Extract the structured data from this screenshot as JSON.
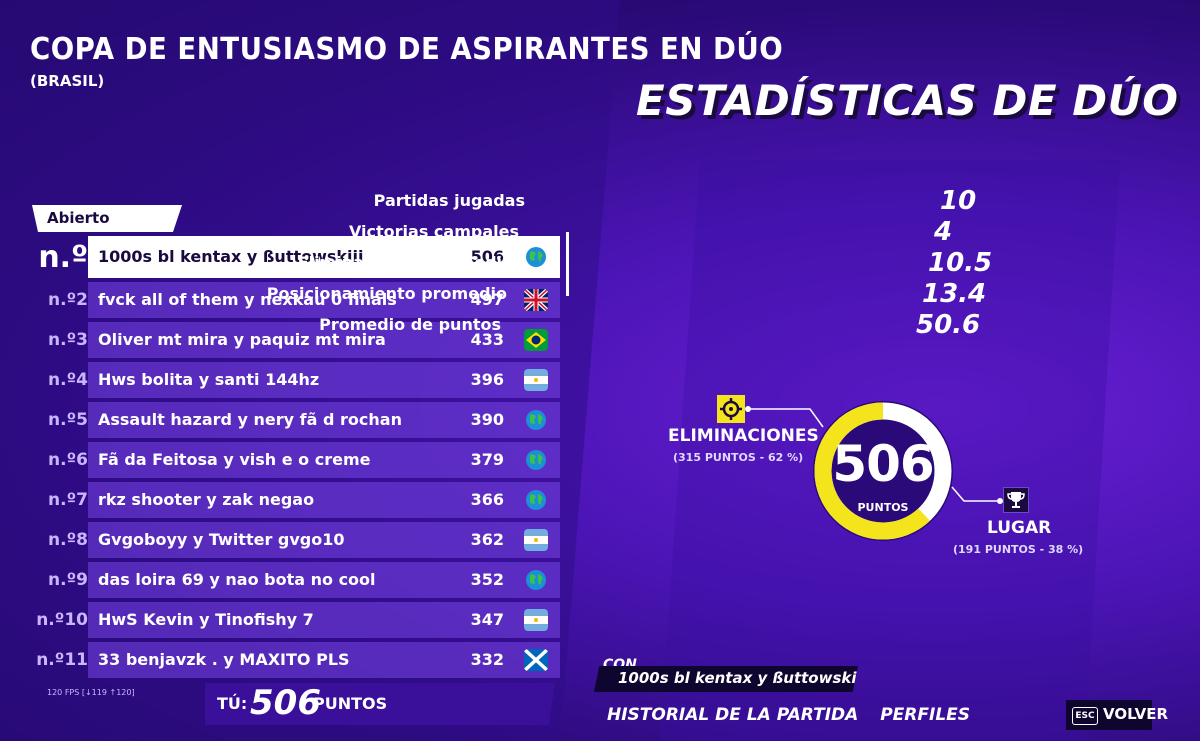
{
  "header": {
    "title": "COPA DE ENTUSIASMO DE ASPIRANTES EN DÚO",
    "subtitle": "(BRASIL)",
    "stats_title": "ESTADÍSTICAS DE DÚO"
  },
  "leaderboard": {
    "tab_label": "Abierto",
    "rows": [
      {
        "rank": "n.º",
        "name": "1000s bl kentax y ßuttowskiii",
        "score": "506",
        "flag": "globe"
      },
      {
        "rank": "n.º2",
        "name": "fvck all of them y nexkau 0 finals",
        "score": "497",
        "flag": "uk"
      },
      {
        "rank": "n.º3",
        "name": "Oliver mt mira y paquiz mt mira",
        "score": "433",
        "flag": "brazil"
      },
      {
        "rank": "n.º4",
        "name": "Hws bolita y santi 144hz",
        "score": "396",
        "flag": "argentina"
      },
      {
        "rank": "n.º5",
        "name": "Assault hazard y nery fã d rochan",
        "score": "390",
        "flag": "globe"
      },
      {
        "rank": "n.º6",
        "name": "Fã da Feitosa y vish e o creme",
        "score": "379",
        "flag": "globe"
      },
      {
        "rank": "n.º7",
        "name": "rkz shooter y zak negao",
        "score": "366",
        "flag": "globe"
      },
      {
        "rank": "n.º8",
        "name": "Gvgoboyy y Twitter gvgo10",
        "score": "362",
        "flag": "argentina"
      },
      {
        "rank": "n.º9",
        "name": "das loira 69 y nao bota no cool",
        "score": "352",
        "flag": "globe"
      },
      {
        "rank": "n.º10",
        "name": "HwS Kevin y Tinofishy 7",
        "score": "347",
        "flag": "argentina"
      },
      {
        "rank": "n.º11",
        "name": "33 benjavzk . y MAXITO PLS",
        "score": "332",
        "flag": "scotland"
      }
    ],
    "you_label": "TÚ:",
    "you_value": "506",
    "you_unit": "PUNTOS",
    "fps": "120 FPS [↓119 ↑120]"
  },
  "stats": [
    {
      "label": "Partidas jugadas",
      "value": "10"
    },
    {
      "label": "Victorias campales",
      "value": "4"
    },
    {
      "label": "Eliminaciones promedio",
      "value": "10.5"
    },
    {
      "label": "Posicionamiento promedio",
      "value": "13.4"
    },
    {
      "label": "Promedio de puntos",
      "value": "50.6"
    }
  ],
  "donut": {
    "total": "506",
    "unit": "PUNTOS",
    "elim_label": "ELIMINACIONES",
    "elim_sub": "(315 PUNTOS - 62 %)",
    "elim_fraction": 0.62,
    "lugar_label": "LUGAR",
    "lugar_sub": "(191 PUNTOS - 38 %)",
    "colors": {
      "elim": "#f4e41b",
      "lugar": "#ffffff"
    }
  },
  "teammate": {
    "label": "CON",
    "name": "1000s bl kentax y ßuttowskiii"
  },
  "bottom_tabs": [
    "HISTORIAL DE LA PARTIDA",
    "PERFILES"
  ],
  "back": {
    "key": "ESC",
    "label": "VOLVER"
  }
}
